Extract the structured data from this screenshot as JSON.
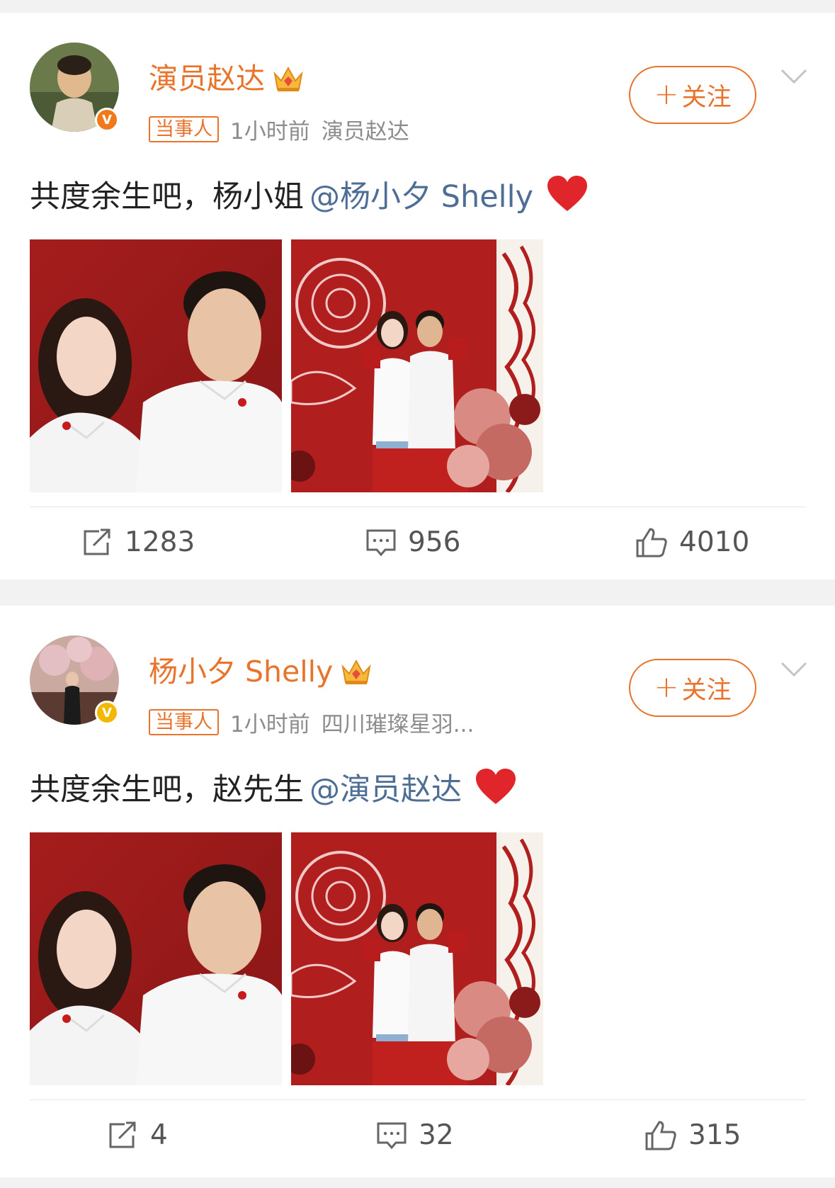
{
  "posts": [
    {
      "username": "演员赵达",
      "badge": "当事人",
      "time": "1小时前",
      "source": "演员赵达",
      "follow_label": "关注",
      "text": "共度余生吧，杨小姐",
      "mention": "@杨小夕 Shelly",
      "actions": {
        "repost": "1283",
        "comment": "956",
        "like": "4010"
      },
      "verified_color": "#f07a1a"
    },
    {
      "username": "杨小夕 Shelly",
      "badge": "当事人",
      "time": "1小时前",
      "source": "四川璀璨星羽...",
      "follow_label": "关注",
      "text": "共度余生吧，赵先生",
      "mention": "@演员赵达",
      "actions": {
        "repost": "4",
        "comment": "32",
        "like": "315"
      },
      "verified_color": "#f5b800"
    }
  ],
  "colors": {
    "accent": "#e8742c",
    "mention": "#4f6e96",
    "background": "#f2f2f2"
  },
  "icons": [
    "crown-icon",
    "verified-icon",
    "plus-icon",
    "chevron-down-icon",
    "heart-icon",
    "repost-icon",
    "comment-icon",
    "like-icon"
  ]
}
